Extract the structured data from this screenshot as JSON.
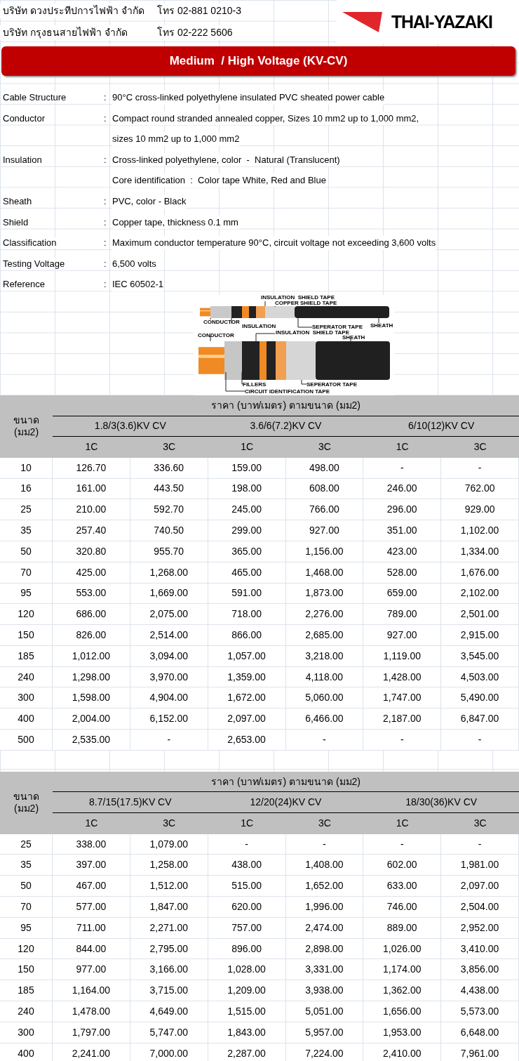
{
  "companies": [
    {
      "name": "บริษัท ดวงประทีปการไฟฟ้า จำกัด",
      "phone": "โทร 02-881 0210-3"
    },
    {
      "name": "บริษัท กรุงธนสายไฟฟ้า จำกัด",
      "phone": "โทร 02-222 5606"
    }
  ],
  "logo": {
    "text": "THAI-YAZAKI"
  },
  "banner": {
    "title": "Medium  / High Voltage (KV-CV)"
  },
  "specs": [
    {
      "label": "Cable Structure",
      "separator": ":",
      "value": "90°C cross-linked polyethylene insulated PVC sheated power cable"
    },
    {
      "label": "Conductor",
      "separator": ":",
      "value": "Compact round stranded annealed copper, Sizes 10 mm2 up to 1,000 mm2,"
    },
    {
      "value": "sizes 10 mm2 up to 1,000 mm2"
    },
    {
      "label": "Insulation",
      "separator": ":",
      "value": "Cross-linked polyethylene, color  -  Natural (Translucent)"
    },
    {
      "value": "Core identification  :  Color tape White, Red and Blue"
    },
    {
      "label": "Sheath",
      "separator": ":",
      "value": "PVC, color - Black"
    },
    {
      "label": "Shield",
      "separator": ":",
      "value": "Copper tape, thickness 0.1 mm"
    },
    {
      "label": "Classification",
      "separator": ":",
      "value": "Maximum conductor temperature 90°C, circuit voltage not exceeding 3,600 volts"
    },
    {
      "label": "Testing Voltage",
      "separator": ":",
      "value": "6,500 volts"
    },
    {
      "label": "Reference",
      "separator": ":",
      "value": "IEC 60502-1"
    }
  ],
  "diagram": {
    "labels": [
      {
        "text": "INSULATION  SHIELD TAPE"
      },
      {
        "text": "COPPER SHIELD TAPE"
      },
      {
        "text": "CONDUCTOR"
      },
      {
        "text": "INSULATION"
      },
      {
        "text": "SEPERATOR TAPE"
      },
      {
        "text": "SHEATH"
      },
      {
        "text": "CONDUCTOR"
      },
      {
        "text": "INSULATION  SHIELD TAPE"
      },
      {
        "text": "SHEATH"
      },
      {
        "text": "FILLERS"
      },
      {
        "text": "SEPERATOR TAPE"
      },
      {
        "text": "CIRCUIT IDENTIFICATION TAPE"
      }
    ]
  },
  "tables": [
    {
      "size_header": [
        "ขนาด",
        "(มม2)"
      ],
      "price_header": "ราคา (บาท/เมตร) ตามขนาด (มม2)",
      "groups": [
        "1.8/3(3.6)KV CV",
        "3.6/6(7.2)KV CV",
        "6/10(12)KV CV"
      ],
      "sub_columns": [
        "1C",
        "3C",
        "1C",
        "3C",
        "1C",
        "3C"
      ],
      "rows": [
        [
          "10",
          "126.70",
          "336.60",
          "159.00",
          "498.00",
          "-",
          "-"
        ],
        [
          "16",
          "161.00",
          "443.50",
          "198.00",
          "608.00",
          "246.00",
          "762.00"
        ],
        [
          "25",
          "210.00",
          "592.70",
          "245.00",
          "766.00",
          "296.00",
          "929.00"
        ],
        [
          "35",
          "257.40",
          "740.50",
          "299.00",
          "927.00",
          "351.00",
          "1,102.00"
        ],
        [
          "50",
          "320.80",
          "955.70",
          "365.00",
          "1,156.00",
          "423.00",
          "1,334.00"
        ],
        [
          "70",
          "425.00",
          "1,268.00",
          "465.00",
          "1,468.00",
          "528.00",
          "1,676.00"
        ],
        [
          "95",
          "553.00",
          "1,669.00",
          "591.00",
          "1,873.00",
          "659.00",
          "2,102.00"
        ],
        [
          "120",
          "686.00",
          "2,075.00",
          "718.00",
          "2,276.00",
          "789.00",
          "2,501.00"
        ],
        [
          "150",
          "826.00",
          "2,514.00",
          "866.00",
          "2,685.00",
          "927.00",
          "2,915.00"
        ],
        [
          "185",
          "1,012.00",
          "3,094.00",
          "1,057.00",
          "3,218.00",
          "1,119.00",
          "3,545.00"
        ],
        [
          "240",
          "1,298.00",
          "3,970.00",
          "1,359.00",
          "4,118.00",
          "1,428.00",
          "4,503.00"
        ],
        [
          "300",
          "1,598.00",
          "4,904.00",
          "1,672.00",
          "5,060.00",
          "1,747.00",
          "5,490.00"
        ],
        [
          "400",
          "2,004.00",
          "6,152.00",
          "2,097.00",
          "6,466.00",
          "2,187.00",
          "6,847.00"
        ],
        [
          "500",
          "2,535.00",
          "-",
          "2,653.00",
          "-",
          "-",
          "-"
        ]
      ]
    },
    {
      "size_header": [
        "ขนาด",
        "(มม2)"
      ],
      "price_header": "ราคา (บาท/เมตร) ตามขนาด (มม2)",
      "groups": [
        "8.7/15(17.5)KV CV",
        "12/20(24)KV CV",
        "18/30(36)KV CV"
      ],
      "sub_columns": [
        "1C",
        "3C",
        "1C",
        "3C",
        "1C",
        "3C"
      ],
      "rows": [
        [
          "25",
          "338.00",
          "1,079.00",
          "-",
          "-",
          "-",
          "-"
        ],
        [
          "35",
          "397.00",
          "1,258.00",
          "438.00",
          "1,408.00",
          "602.00",
          "1,981.00"
        ],
        [
          "50",
          "467.00",
          "1,512.00",
          "515.00",
          "1,652.00",
          "633.00",
          "2,097.00"
        ],
        [
          "70",
          "577.00",
          "1,847.00",
          "620.00",
          "1,996.00",
          "746.00",
          "2,504.00"
        ],
        [
          "95",
          "711.00",
          "2,271.00",
          "757.00",
          "2,474.00",
          "889.00",
          "2,952.00"
        ],
        [
          "120",
          "844.00",
          "2,795.00",
          "896.00",
          "2,898.00",
          "1,026.00",
          "3,410.00"
        ],
        [
          "150",
          "977.00",
          "3,166.00",
          "1,028.00",
          "3,331.00",
          "1,174.00",
          "3,856.00"
        ],
        [
          "185",
          "1,164.00",
          "3,715.00",
          "1,209.00",
          "3,938.00",
          "1,362.00",
          "4,438.00"
        ],
        [
          "240",
          "1,478.00",
          "4,649.00",
          "1,515.00",
          "5,051.00",
          "1,656.00",
          "5,573.00"
        ],
        [
          "300",
          "1,797.00",
          "5,747.00",
          "1,843.00",
          "5,957.00",
          "1,953.00",
          "6,648.00"
        ],
        [
          "400",
          "2,241.00",
          "7,000.00",
          "2,287.00",
          "7,224.00",
          "2,410.00",
          "7,961.00"
        ]
      ]
    }
  ]
}
